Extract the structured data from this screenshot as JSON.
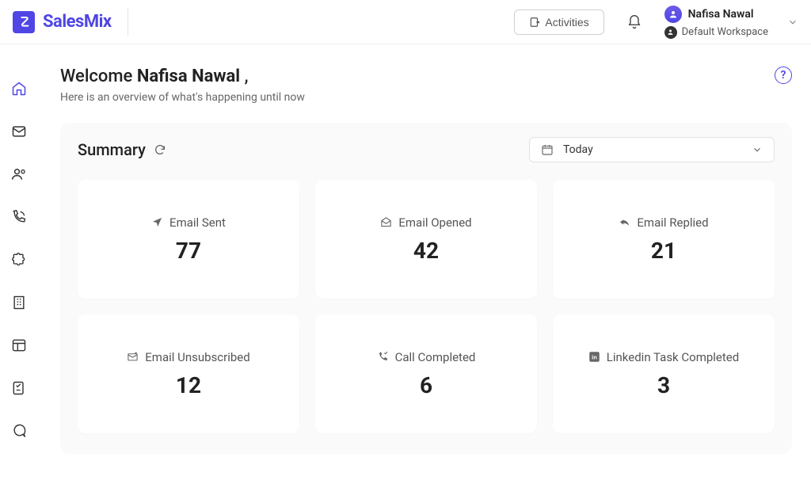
{
  "brand": {
    "name": "SalesMix"
  },
  "header": {
    "activities_label": "Activities",
    "user_name": "Nafisa Nawal",
    "workspace": "Default Workspace"
  },
  "welcome": {
    "prefix": "Welcome ",
    "name": "Nafisa Nawal",
    "suffix": " ,",
    "subtitle": "Here is an overview of what's happening until now"
  },
  "summary": {
    "title": "Summary",
    "range_label": "Today",
    "cards": [
      {
        "label": "Email Sent",
        "value": "77",
        "icon": "send"
      },
      {
        "label": "Email Opened",
        "value": "42",
        "icon": "open"
      },
      {
        "label": "Email Replied",
        "value": "21",
        "icon": "reply"
      },
      {
        "label": "Email Unsubscribed",
        "value": "12",
        "icon": "unsub"
      },
      {
        "label": "Call Completed",
        "value": "6",
        "icon": "phone"
      },
      {
        "label": "Linkedin Task Completed",
        "value": "3",
        "icon": "linkedin"
      }
    ]
  }
}
